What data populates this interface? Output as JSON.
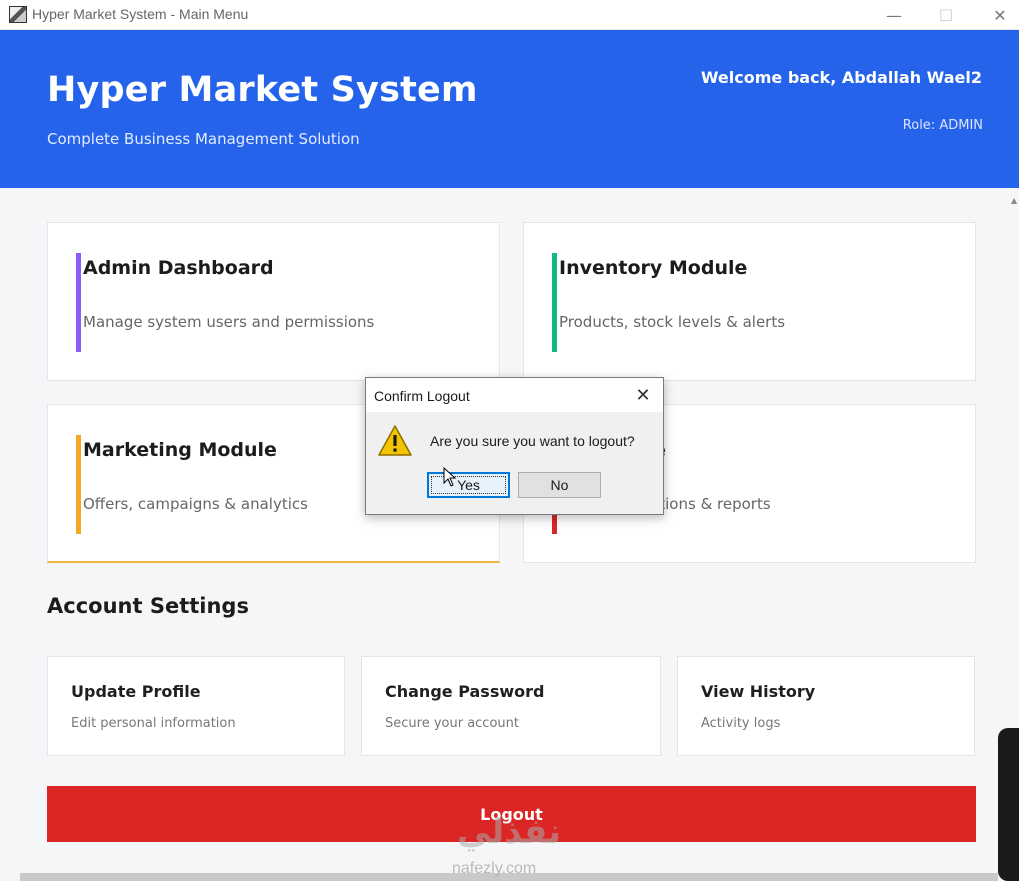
{
  "window": {
    "title": "Hyper Market System - Main Menu",
    "controls": {
      "minimize": "—",
      "maximize": "☐",
      "close": "✕"
    }
  },
  "header": {
    "title": "Hyper Market System",
    "subtitle": "Complete Business Management Solution",
    "welcome": "Welcome back, Abdallah Wael2",
    "role": "Role: ADMIN",
    "background_color": "#2563eb"
  },
  "modules": [
    {
      "title": "Admin Dashboard",
      "description": "Manage system users and permissions",
      "accent_color": "#8b5cf6"
    },
    {
      "title": "Inventory Module",
      "description": "Products, stock levels & alerts",
      "accent_color": "#10b981"
    },
    {
      "title": "Marketing Module",
      "description": "Offers, campaigns & analytics",
      "accent_color": "#f5a623"
    },
    {
      "title": "ule",
      "description": "ctions & reports",
      "accent_color": "#dc2626"
    }
  ],
  "account_settings": {
    "title": "Account Settings",
    "items": [
      {
        "title": "Update Profile",
        "description": "Edit personal information"
      },
      {
        "title": "Change Password",
        "description": "Secure your account"
      },
      {
        "title": "View History",
        "description": "Activity logs"
      }
    ]
  },
  "logout": {
    "label": "Logout",
    "color": "#dc2626"
  },
  "dialog": {
    "title": "Confirm Logout",
    "close": "✕",
    "message": "Are you sure you want to logout?",
    "icon": "warning-icon",
    "yes_label": "Yes",
    "no_label": "No"
  },
  "watermark": {
    "arabic": "نفذلي",
    "latin": "nafezly.com"
  }
}
